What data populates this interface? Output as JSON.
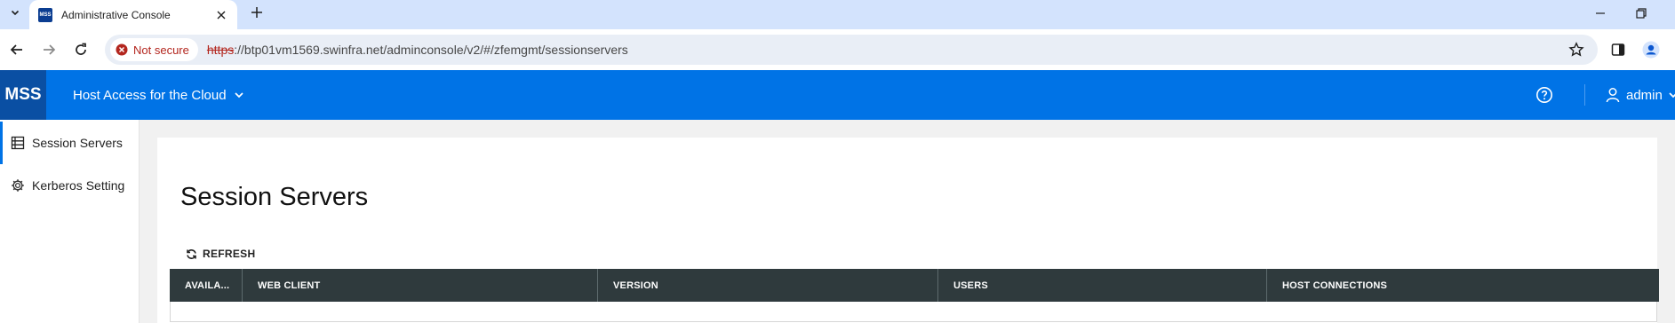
{
  "browser": {
    "tab_title": "Administrative Console",
    "favicon_text": "MSS",
    "security_label": "Not secure",
    "url_protocol": "https",
    "url_rest": "://btp01vm1569.swinfra.net/adminconsole/v2/#/zfemgmt/sessionservers"
  },
  "header": {
    "logo": "MSS",
    "product": "Host Access for the Cloud",
    "user": "admin",
    "accent_color": "#0073e6"
  },
  "sidebar": {
    "items": [
      {
        "label": "Session Servers",
        "icon": "server-list-icon",
        "active": true
      },
      {
        "label": "Kerberos Setting",
        "icon": "gear-icon",
        "active": false
      }
    ]
  },
  "main": {
    "title": "Session Servers",
    "refresh_label": "REFRESH",
    "columns": [
      "AVAILA...",
      "WEB CLIENT",
      "VERSION",
      "USERS",
      "HOST CONNECTIONS"
    ]
  }
}
